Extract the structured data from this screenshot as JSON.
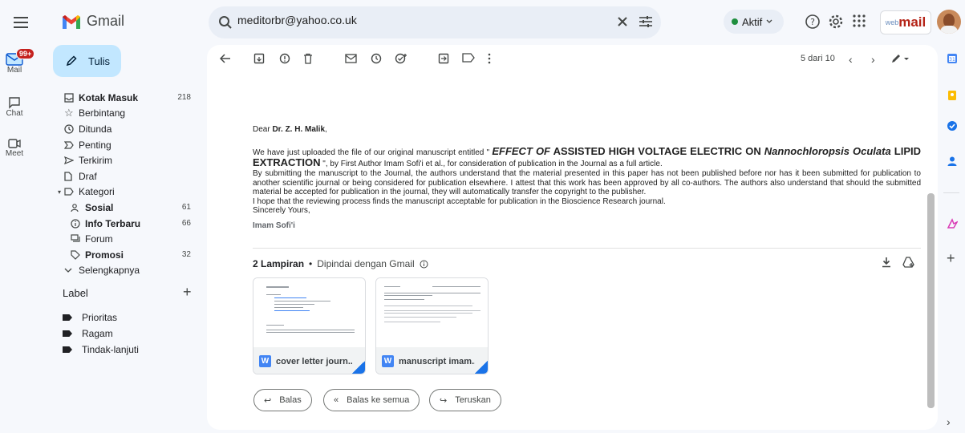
{
  "header": {
    "app_name": "Gmail",
    "search_value": "meditorbr@yahoo.co.uk",
    "status_label": "Aktif",
    "brand_prefix": "web",
    "brand_main": "mail"
  },
  "rail": {
    "mail_label": "Mail",
    "mail_badge": "99+",
    "chat_label": "Chat",
    "meet_label": "Meet"
  },
  "compose_label": "Tulis",
  "nav": {
    "items": [
      {
        "label": "Kotak Masuk",
        "count": "218"
      },
      {
        "label": "Berbintang",
        "count": ""
      },
      {
        "label": "Ditunda",
        "count": ""
      },
      {
        "label": "Penting",
        "count": ""
      },
      {
        "label": "Terkirim",
        "count": ""
      },
      {
        "label": "Draf",
        "count": ""
      },
      {
        "label": "Kategori",
        "count": ""
      },
      {
        "label": "Sosial",
        "count": "61"
      },
      {
        "label": "Info Terbaru",
        "count": "66"
      },
      {
        "label": "Forum",
        "count": ""
      },
      {
        "label": "Promosi",
        "count": "32"
      },
      {
        "label": "Selengkapnya",
        "count": ""
      }
    ]
  },
  "labels": {
    "heading": "Label",
    "items": [
      "Prioritas",
      "Ragam",
      "Tindak-lanjuti"
    ]
  },
  "toolbar": {
    "page_info": "5 dari 10"
  },
  "email": {
    "salutation_prefix": "Dear ",
    "salutation_name": "Dr. Z. H. Malik",
    "salutation_suffix": ",",
    "p1_a": "We have just uploaded the file of our original manuscript entitled \" ",
    "p1_title_a": "EFFECT OF",
    "p1_title_b": " ASSISTED HIGH VOLTAGE ELECTRIC ON ",
    "p1_title_c": "Nannochloropsis Oculata",
    "p1_title_d": " LIPID EXTRACTION",
    "p1_b": " \", by First Author Imam Sofi'i et al., for consideration of publication in the Journal as a full article.",
    "p2": "By submitting the manuscript to the Journal, the authors understand that the material presented in this paper has not been published before nor has it been submitted for publication to another scientific journal or being considered for publication elsewhere. I attest that this work has been approved by all co-authors. The authors also understand that should the submitted material be accepted for publication in the journal, they will automatically transfer the copyright to the publisher.",
    "p3": "I hope that the reviewing process finds the manuscript acceptable for publication in the Bioscience Research journal.",
    "p4": "Sincerely Yours,",
    "signature": "Imam Sofi'i"
  },
  "attachments": {
    "count_label": "2 Lampiran",
    "separator": "•",
    "scan_label": "Dipindai dengan Gmail",
    "files": [
      {
        "name": "cover letter journ...",
        "type_badge": "W"
      },
      {
        "name": "manuscript imam...",
        "type_badge": "W"
      }
    ]
  },
  "actions": {
    "reply": "Balas",
    "reply_all": "Balas ke semua",
    "forward": "Teruskan"
  },
  "colors": {
    "compose_bg": "#c2e7ff",
    "page_bg": "#f6f8fc",
    "status_green": "#1e8e3e",
    "badge_red": "#c5221f"
  }
}
